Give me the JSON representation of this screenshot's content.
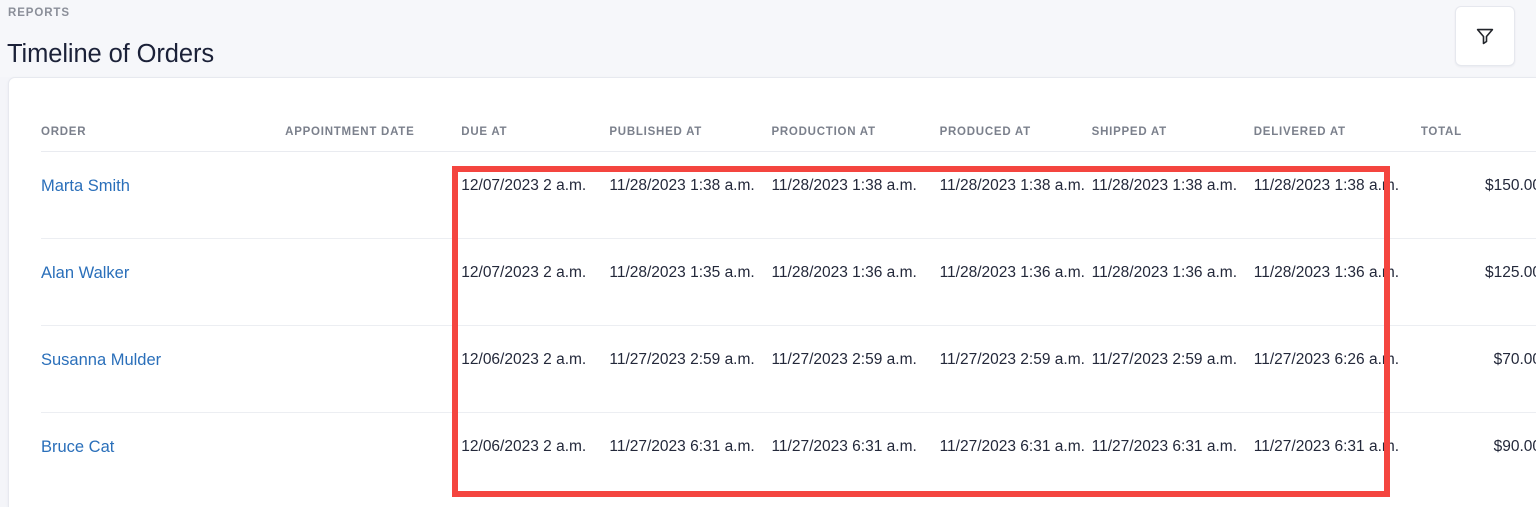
{
  "header": {
    "eyebrow": "REPORTS",
    "title": "Timeline of Orders",
    "filter_icon": "funnel-filter-icon"
  },
  "table": {
    "columns": [
      "ORDER",
      "APPOINTMENT DATE",
      "DUE AT",
      "PUBLISHED AT",
      "PRODUCTION AT",
      "PRODUCED AT",
      "SHIPPED AT",
      "DELIVERED AT",
      "TOTAL"
    ],
    "rows": [
      {
        "order": "Marta Smith",
        "appointment_date": "",
        "due_at": "12/07/2023 2 a.m.",
        "published_at": "11/28/2023 1:38 a.m.",
        "production_at": "11/28/2023 1:38 a.m.",
        "produced_at": "11/28/2023 1:38 a.m.",
        "shipped_at": "11/28/2023 1:38 a.m.",
        "delivered_at": "11/28/2023 1:38 a.m.",
        "total": "$150.00"
      },
      {
        "order": "Alan Walker",
        "appointment_date": "",
        "due_at": "12/07/2023 2 a.m.",
        "published_at": "11/28/2023 1:35 a.m.",
        "production_at": "11/28/2023 1:36 a.m.",
        "produced_at": "11/28/2023 1:36 a.m.",
        "shipped_at": "11/28/2023 1:36 a.m.",
        "delivered_at": "11/28/2023 1:36 a.m.",
        "total": "$125.00"
      },
      {
        "order": "Susanna Mulder",
        "appointment_date": "",
        "due_at": "12/06/2023 2 a.m.",
        "published_at": "11/27/2023 2:59 a.m.",
        "production_at": "11/27/2023 2:59 a.m.",
        "produced_at": "11/27/2023 2:59 a.m.",
        "shipped_at": "11/27/2023 2:59 a.m.",
        "delivered_at": "11/27/2023 6:26 a.m.",
        "total": "$70.00"
      },
      {
        "order": "Bruce Cat",
        "appointment_date": "",
        "due_at": "12/06/2023 2 a.m.",
        "published_at": "11/27/2023 6:31 a.m.",
        "production_at": "11/27/2023 6:31 a.m.",
        "produced_at": "11/27/2023 6:31 a.m.",
        "shipped_at": "11/27/2023 6:31 a.m.",
        "delivered_at": "11/27/2023 6:31 a.m.",
        "total": "$90.00"
      }
    ]
  },
  "annotation": {
    "highlight_color": "#f4453f"
  },
  "colors": {
    "link": "#2a6fba",
    "page_background": "#f4f5f9",
    "card_background": "#ffffff",
    "header_text": "#1b2138",
    "muted_text": "#7b808c"
  }
}
